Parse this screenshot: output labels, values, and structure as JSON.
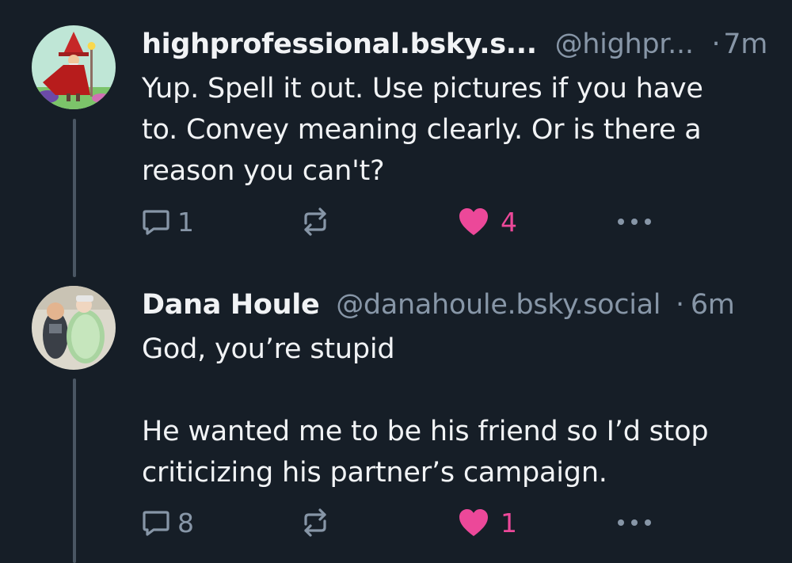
{
  "colors": {
    "background": "#161e27",
    "text": "#f1f3f5",
    "muted": "#8796a7",
    "like": "#ec4899",
    "thread_line": "#4a5663"
  },
  "posts": [
    {
      "display_name": "highprofessional.bsky.s...",
      "handle": "@highpr...",
      "separator": "·",
      "time": "7m",
      "body": [
        "Yup. Spell it out. Use pictures if you have",
        "to. Convey meaning clearly. Or is there a",
        "reason you can't?"
      ],
      "replies": "1",
      "reposts": "",
      "likes": "4",
      "liked": true,
      "avatar_icon": "wizard-avatar"
    },
    {
      "display_name": "Dana Houle",
      "handle": "@danahoule.bsky.social",
      "separator": "·",
      "time": "6m",
      "body": [
        "God, you’re stupid",
        "",
        "He wanted me to be his friend so I’d stop",
        "criticizing his partner’s campaign."
      ],
      "replies": "8",
      "reposts": "",
      "likes": "1",
      "liked": true,
      "avatar_icon": "babies-photo-avatar"
    }
  ]
}
